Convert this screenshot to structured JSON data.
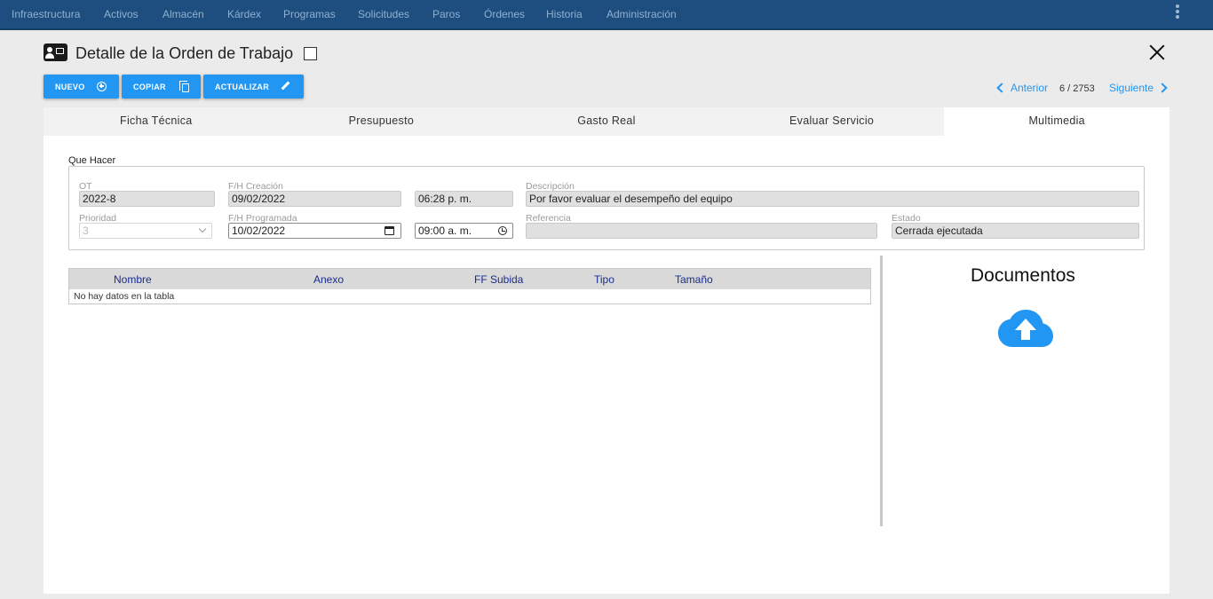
{
  "nav": {
    "items": [
      "Infraestructura",
      "Activos",
      "Almacén",
      "Kárdex",
      "Programas",
      "Solicitudes",
      "Paros",
      "Órdenes",
      "Historia",
      "Administración"
    ]
  },
  "header": {
    "title": "Detalle de la Orden de Trabajo"
  },
  "toolbar": {
    "nuevo": "NUEVO",
    "copiar": "COPIAR",
    "actualizar": "ACTUALIZAR"
  },
  "pager": {
    "prev": "Anterior",
    "count": "6 / 2753",
    "next": "Siguiente"
  },
  "tabs": [
    "Ficha Técnica",
    "Presupuesto",
    "Gasto Real",
    "Evaluar Servicio",
    "Multimedia"
  ],
  "form": {
    "section": "Que Hacer",
    "ot_label": "OT",
    "ot_value": "2022-8",
    "creacion_label": "F/H Creación",
    "creacion_date": "09/02/2022",
    "creacion_time": "06:28 p. m.",
    "descripcion_label": "Descripción",
    "descripcion_value": "Por favor evaluar el desempeño del equipo",
    "prioridad_label": "Prioridad",
    "prioridad_value": "3",
    "programada_label": "F/H Programada",
    "programada_date": "10/02/2022",
    "programada_time": "09:00 a. m.",
    "referencia_label": "Referencia",
    "referencia_value": "",
    "estado_label": "Estado",
    "estado_value": "Cerrada ejecutada"
  },
  "table": {
    "columns": [
      "Nombre",
      "Anexo",
      "FF Subida",
      "Tipo",
      "Tamaño"
    ],
    "empty": "No hay datos en la tabla"
  },
  "docs": {
    "title": "Documentos",
    "upload_icon": "cloud-upload-icon",
    "upload_color": "#2196f3"
  }
}
